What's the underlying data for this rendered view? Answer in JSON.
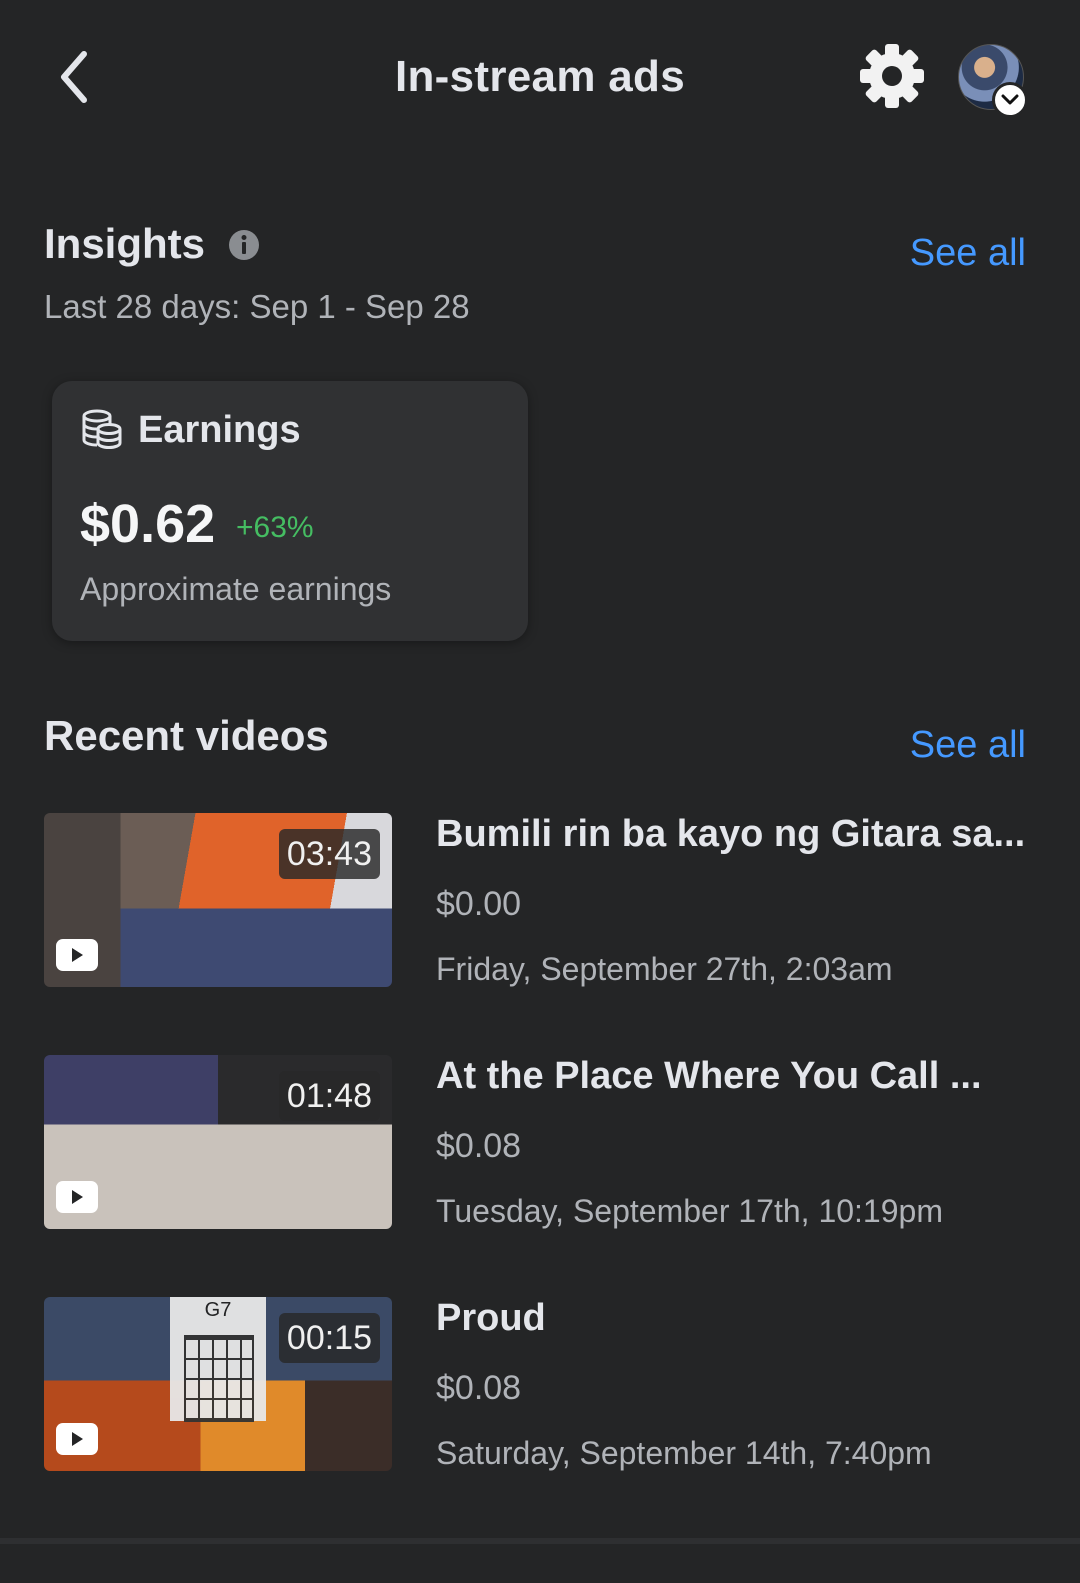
{
  "header": {
    "title": "In-stream ads",
    "back_icon": "chevron-left-icon",
    "settings_icon": "gear-icon",
    "avatar_badge_icon": "chevron-down-icon"
  },
  "insights": {
    "title": "Insights",
    "see_all": "See all",
    "date_range": "Last 28 days: Sep 1 - Sep 28",
    "earnings": {
      "label": "Earnings",
      "value": "$0.62",
      "change": "+63%",
      "subtitle": "Approximate earnings"
    }
  },
  "recent_videos": {
    "title": "Recent videos",
    "see_all": "See all",
    "items": [
      {
        "title": "Bumili rin ba kayo ng Gitara sa...",
        "duration": "03:43",
        "earnings": "$0.00",
        "date": "Friday, September 27th, 2:03am"
      },
      {
        "title": "At the Place Where You Call ...",
        "duration": "01:48",
        "earnings": "$0.08",
        "date": "Tuesday, September 17th, 10:19pm"
      },
      {
        "title": "Proud",
        "duration": "00:15",
        "earnings": "$0.08",
        "date": "Saturday, September 14th, 7:40pm",
        "chord_label": "G7"
      }
    ]
  },
  "colors": {
    "background": "#242526",
    "card": "#303133",
    "link": "#4599ff",
    "positive": "#45bd62"
  }
}
